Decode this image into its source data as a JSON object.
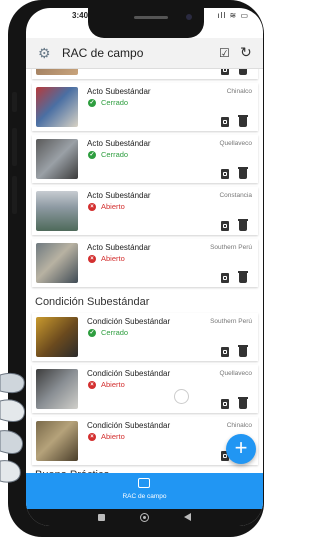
{
  "status_bar": {
    "time": "3:40",
    "icons": "ıll ≋ ▭"
  },
  "app_bar": {
    "title": "RAC de campo"
  },
  "colors": {
    "accent": "#2196f3",
    "closed": "#2e9e3f",
    "open": "#d32f2f"
  },
  "cards": [
    {
      "title": "Acto Subestándar",
      "status": "Cerrado",
      "location": "Chinalco"
    },
    {
      "title": "Acto Subestándar",
      "status": "Cerrado",
      "location": "Quellaveco"
    },
    {
      "title": "Acto Subestándar",
      "status": "Abierto",
      "location": "Constancia"
    },
    {
      "title": "Acto Subestándar",
      "status": "Abierto",
      "location": "Southern Perú"
    },
    {
      "title": "Condición Subestándar",
      "status": "Cerrado",
      "location": "Southern Perú"
    },
    {
      "title": "Condición Subestándar",
      "status": "Abierto",
      "location": "Quellaveco"
    },
    {
      "title": "Condición Subestándar",
      "status": "Abierto",
      "location": "Chinalco"
    }
  ],
  "sections": {
    "condicion": "Condición Subestándar",
    "buena": "Buena Práctica"
  },
  "fab": {
    "label": "+"
  },
  "bottom_nav": {
    "label": "RAC de campo"
  }
}
